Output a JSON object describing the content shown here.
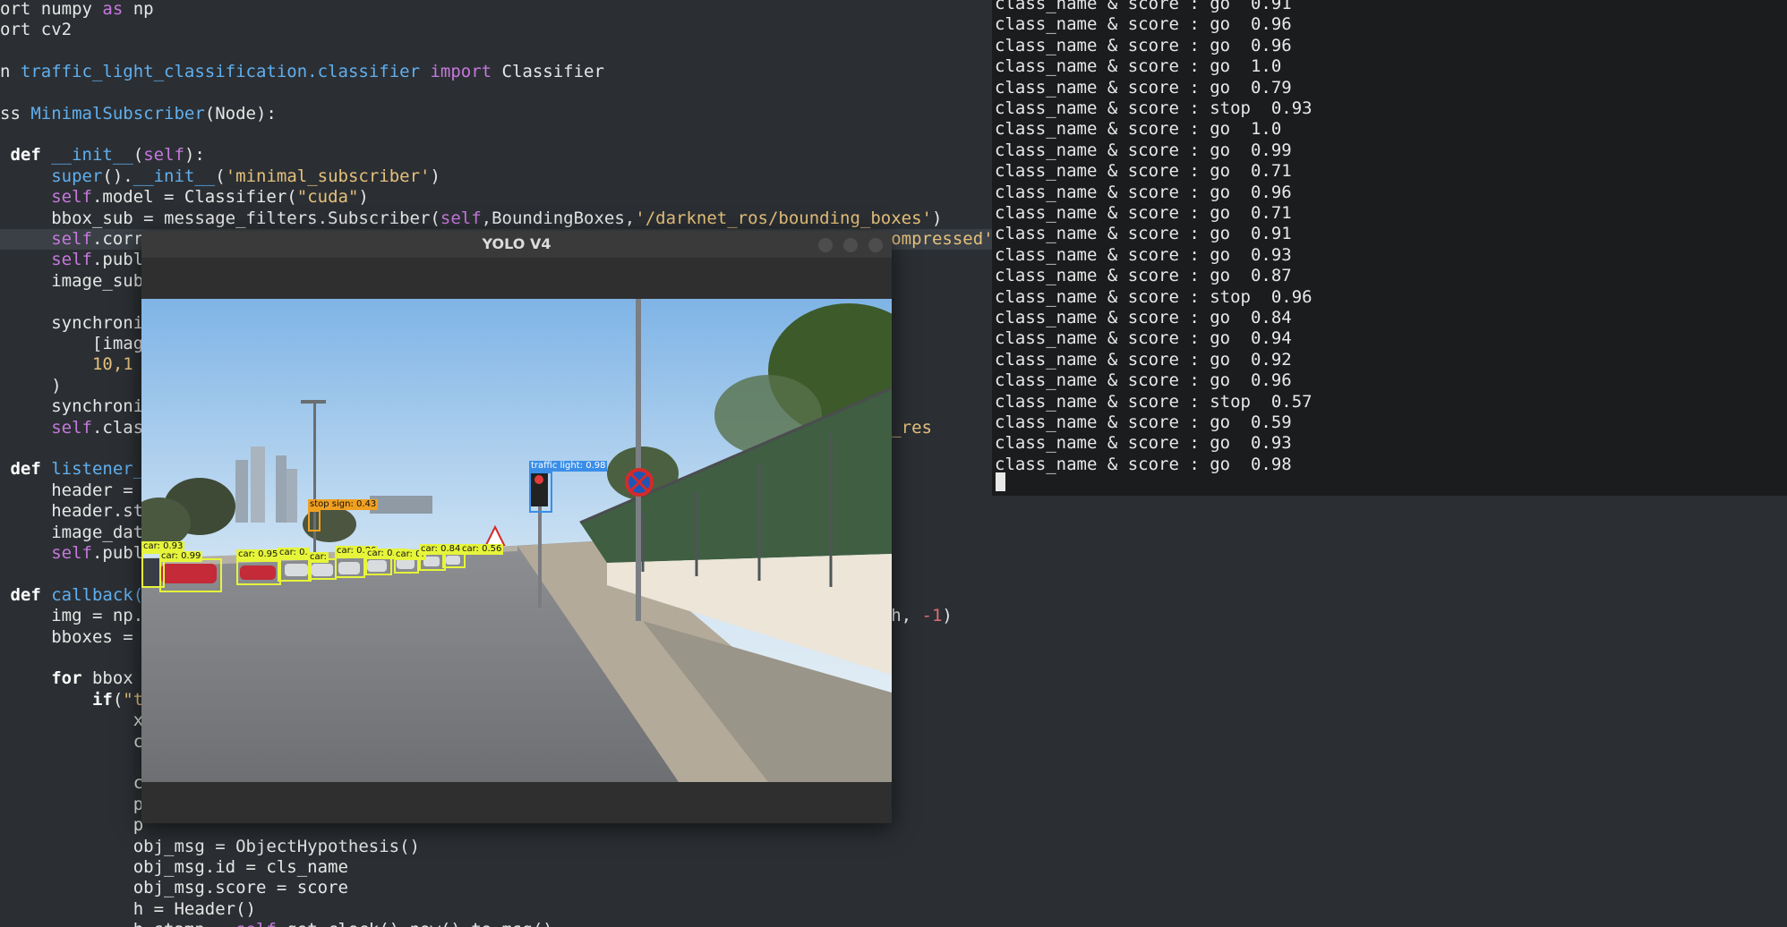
{
  "editor": {
    "lines": [
      [
        {
          "c": "pl",
          "t": "ort numpy "
        },
        {
          "c": "kw",
          "t": "as"
        },
        {
          "c": "pl",
          "t": " np"
        }
      ],
      [
        {
          "c": "pl",
          "t": "ort cv2"
        }
      ],
      [],
      [
        {
          "c": "pl",
          "t": "n "
        },
        {
          "c": "bi",
          "t": "traffic_light_classification.classifier"
        },
        {
          "c": "pl",
          "t": " "
        },
        {
          "c": "kw",
          "t": "import"
        },
        {
          "c": "pl",
          "t": " Classifier"
        }
      ],
      [],
      [
        {
          "c": "pl",
          "t": "ss "
        },
        {
          "c": "bi",
          "t": "MinimalSubscriber"
        },
        {
          "c": "pl",
          "t": "(Node):"
        }
      ],
      [],
      [
        {
          "c": "def",
          "t": " def"
        },
        {
          "c": "pl",
          "t": " "
        },
        {
          "c": "bi",
          "t": "__init__"
        },
        {
          "c": "pl",
          "t": "("
        },
        {
          "c": "kw",
          "t": "self"
        },
        {
          "c": "pl",
          "t": "):"
        }
      ],
      [
        {
          "c": "pl",
          "t": "     "
        },
        {
          "c": "bi",
          "t": "super"
        },
        {
          "c": "pl",
          "t": "()."
        },
        {
          "c": "bi",
          "t": "__init__"
        },
        {
          "c": "pl",
          "t": "("
        },
        {
          "c": "str",
          "t": "'minimal_subscriber'"
        },
        {
          "c": "pl",
          "t": ")"
        }
      ],
      [
        {
          "c": "pl",
          "t": "     "
        },
        {
          "c": "kw",
          "t": "self"
        },
        {
          "c": "pl",
          "t": ".model = Classifier("
        },
        {
          "c": "str",
          "t": "\"cuda\""
        },
        {
          "c": "pl",
          "t": ")"
        }
      ],
      [
        {
          "c": "pl",
          "t": "     bbox_sub = message_filters.Subscriber("
        },
        {
          "c": "kw",
          "t": "self"
        },
        {
          "c": "pl",
          "t": ",BoundingBoxes,"
        },
        {
          "c": "str",
          "t": "'/darknet_ros/bounding_boxes'"
        },
        {
          "c": "pl",
          "t": ")"
        }
      ],
      [
        {
          "c": "pl",
          "t": "     "
        },
        {
          "c": "kw",
          "t": "self"
        },
        {
          "c": "pl",
          "t": ".corrected_image = "
        },
        {
          "c": "kw",
          "t": "self"
        },
        {
          "c": "pl",
          "t": ".create_subscription(Image, "
        },
        {
          "c": "str",
          "t": "'/image_raw/camera0_sec/uncompressed'"
        }
      ],
      [
        {
          "c": "pl",
          "t": "     "
        },
        {
          "c": "kw",
          "t": "self"
        },
        {
          "c": "pl",
          "t": ".publ"
        }
      ],
      [
        {
          "c": "pl",
          "t": "     image_sub"
        }
      ],
      [],
      [
        {
          "c": "pl",
          "t": "     synchroni"
        }
      ],
      [
        {
          "c": "pl",
          "t": "         [imag"
        }
      ],
      [
        {
          "c": "pl",
          "t": "         "
        },
        {
          "c": "str",
          "t": "10,1"
        }
      ],
      [
        {
          "c": "pl",
          "t": "     )"
        }
      ],
      [
        {
          "c": "pl",
          "t": "     synchroni"
        }
      ],
      [
        {
          "c": "pl",
          "t": "     "
        },
        {
          "c": "kw",
          "t": "self"
        },
        {
          "c": "pl",
          "t": ".clas                                                                   "
        },
        {
          "c": "str",
          "t": "cation_res"
        }
      ],
      [],
      [
        {
          "c": "def",
          "t": " def"
        },
        {
          "c": "pl",
          "t": " "
        },
        {
          "c": "bi",
          "t": "listener_"
        }
      ],
      [
        {
          "c": "pl",
          "t": "     header ="
        }
      ],
      [
        {
          "c": "pl",
          "t": "     header.st"
        }
      ],
      [
        {
          "c": "pl",
          "t": "     image_dat"
        }
      ],
      [
        {
          "c": "pl",
          "t": "     "
        },
        {
          "c": "kw",
          "t": "self"
        },
        {
          "c": "pl",
          "t": ".publ"
        }
      ],
      [],
      [
        {
          "c": "def",
          "t": " def"
        },
        {
          "c": "pl",
          "t": " "
        },
        {
          "c": "bi",
          "t": "callback("
        }
      ],
      [
        {
          "c": "pl",
          "t": "     img = np.                                                          image_data.width, "
        },
        {
          "c": "num",
          "t": "-1"
        },
        {
          "c": "pl",
          "t": ")"
        }
      ],
      [
        {
          "c": "pl",
          "t": "     bboxes ="
        }
      ],
      [],
      [
        {
          "c": "pl",
          "t": "     "
        },
        {
          "c": "def",
          "t": "for"
        },
        {
          "c": "pl",
          "t": " bbox"
        }
      ],
      [
        {
          "c": "pl",
          "t": "         "
        },
        {
          "c": "def",
          "t": "if"
        },
        {
          "c": "pl",
          "t": "("
        },
        {
          "c": "str",
          "t": "\"t"
        }
      ],
      [
        {
          "c": "pl",
          "t": "             x"
        }
      ],
      [
        {
          "c": "pl",
          "t": "             c"
        }
      ],
      [],
      [
        {
          "c": "pl",
          "t": "             c"
        }
      ],
      [
        {
          "c": "pl",
          "t": "             p"
        }
      ],
      [
        {
          "c": "pl",
          "t": "             p"
        }
      ],
      [
        {
          "c": "pl",
          "t": "             obj_msg = ObjectHypothesis()"
        }
      ],
      [
        {
          "c": "pl",
          "t": "             obj_msg.id = cls_name"
        }
      ],
      [
        {
          "c": "pl",
          "t": "             obj_msg.score = score"
        }
      ],
      [
        {
          "c": "pl",
          "t": "             h = Header()"
        }
      ],
      [
        {
          "c": "pl",
          "t": "             h.stamp = "
        },
        {
          "c": "kw",
          "t": "self"
        },
        {
          "c": "pl",
          "t": ".get_clock().now().to_msg()"
        }
      ]
    ]
  },
  "terminal": {
    "lines": [
      "class_name & score : go  0.91",
      "class_name & score : go  0.96",
      "class_name & score : go  0.96",
      "class_name & score : go  1.0",
      "class_name & score : go  0.79",
      "class_name & score : stop  0.93",
      "class_name & score : go  1.0",
      "class_name & score : go  0.99",
      "class_name & score : go  0.71",
      "class_name & score : go  0.96",
      "class_name & score : go  0.71",
      "class_name & score : go  0.91",
      "class_name & score : go  0.93",
      "class_name & score : go  0.87",
      "class_name & score : stop  0.96",
      "class_name & score : go  0.84",
      "class_name & score : go  0.94",
      "class_name & score : go  0.92",
      "class_name & score : go  0.96",
      "class_name & score : stop  0.57",
      "class_name & score : go  0.59",
      "class_name & score : go  0.93",
      "class_name & score : go  0.98"
    ]
  },
  "yolo_window": {
    "title": "YOLO V4",
    "detections": {
      "traffic_light": "traffic light: 0.98",
      "stop_sign": "stop sign: 0.43",
      "cars": [
        "car: 0.93",
        "car: 0.99",
        "car: 0.95",
        "car: 0.",
        "car:",
        "car: 0.86",
        "car: 0.85",
        "car: 0.",
        "car: 0.84",
        "car: 0.56"
      ]
    },
    "colors": {
      "car_box": "#e6f53a",
      "traffic_light_box": "#3a8ee8",
      "stop_sign_box": "#f0a020"
    }
  }
}
